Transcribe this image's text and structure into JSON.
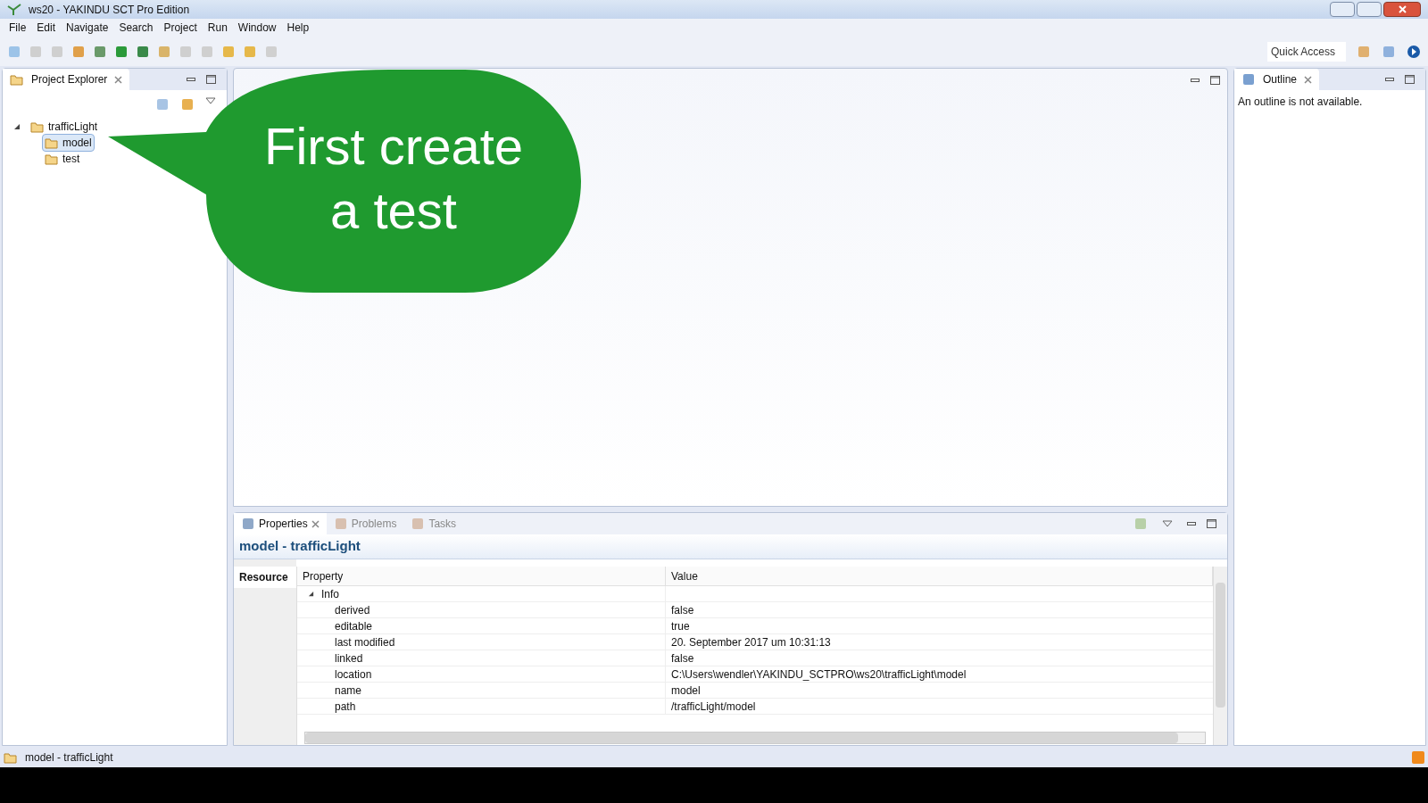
{
  "window": {
    "title": "ws20 - YAKINDU SCT Pro Edition"
  },
  "menu": [
    "File",
    "Edit",
    "Navigate",
    "Search",
    "Project",
    "Run",
    "Window",
    "Help"
  ],
  "quick_access": {
    "placeholder": "Quick Access"
  },
  "project_explorer": {
    "title": "Project Explorer",
    "tree": [
      {
        "label": "trafficLight",
        "expanded": true,
        "selected": false,
        "children": [
          {
            "label": "model",
            "selected": true
          },
          {
            "label": "test",
            "selected": false
          }
        ]
      }
    ]
  },
  "callout": {
    "lines": [
      "First create",
      "a test"
    ]
  },
  "outline": {
    "title": "Outline",
    "message": "An outline is not available."
  },
  "properties": {
    "tabs": [
      {
        "label": "Properties",
        "selected": true
      },
      {
        "label": "Problems",
        "selected": false
      },
      {
        "label": "Tasks",
        "selected": false
      }
    ],
    "heading": "model - trafficLight",
    "side_tabs": [
      {
        "label": "Resource",
        "selected": true
      }
    ],
    "columns": [
      "Property",
      "Value"
    ],
    "groups": [
      {
        "label": "Info",
        "expanded": true,
        "rows": [
          {
            "property": "derived",
            "value": "false"
          },
          {
            "property": "editable",
            "value": "true"
          },
          {
            "property": "last modified",
            "value": "20. September 2017 um 10:31:13"
          },
          {
            "property": "linked",
            "value": "false"
          },
          {
            "property": "location",
            "value": "C:\\Users\\wendler\\YAKINDU_SCTPRO\\ws20\\trafficLight\\model"
          },
          {
            "property": "name",
            "value": "model"
          },
          {
            "property": "path",
            "value": "/trafficLight/model"
          }
        ]
      }
    ]
  },
  "status_bar": {
    "text": "model - trafficLight"
  }
}
